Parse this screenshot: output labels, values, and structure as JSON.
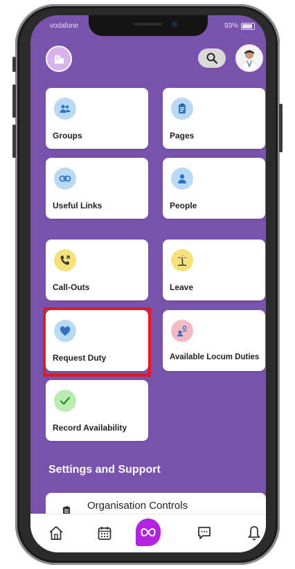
{
  "status": {
    "carrier": "vodafone",
    "battery": "93%"
  },
  "header": {
    "logo_icon": "building-icon",
    "search_icon": "search-icon",
    "avatar": "doctor-avatar"
  },
  "cards": [
    {
      "id": "groups",
      "label": "Groups",
      "icon": "people-icon",
      "icon_bg": "#b9d9f5",
      "icon_color": "#2f72c4"
    },
    {
      "id": "pages",
      "label": "Pages",
      "icon": "clipboard-icon",
      "icon_bg": "#b9d9f5",
      "icon_color": "#2f72c4"
    },
    {
      "id": "useful-links",
      "label": "Useful Links",
      "icon": "link-icon",
      "icon_bg": "#b9d9f5",
      "icon_color": "#2f72c4"
    },
    {
      "id": "people",
      "label": "People",
      "icon": "person-icon",
      "icon_bg": "#b9d9f5",
      "icon_color": "#2f72c4"
    },
    {
      "id": "call-outs",
      "label": "Call-Outs",
      "icon": "phone-callout-icon",
      "icon_bg": "#f5e27a",
      "icon_color": "#3a3a3a"
    },
    {
      "id": "leave",
      "label": "Leave",
      "icon": "palm-tree-icon",
      "icon_bg": "#f5e27a",
      "icon_color": "#3a3a3a"
    },
    {
      "id": "request-duty",
      "label": "Request Duty",
      "icon": "heart-icon",
      "icon_bg": "#b9d9f5",
      "icon_color": "#2f72c4"
    },
    {
      "id": "available-locum-duties",
      "label": "Available Locum Duties",
      "icon": "locum-person-icon",
      "icon_bg": "#f5b9c4",
      "icon_color": "#2f72c4"
    },
    {
      "id": "record-availability",
      "label": "Record Availability",
      "icon": "checkmark-icon",
      "icon_bg": "#b9ecb0",
      "icon_color": "#2e8b2e"
    }
  ],
  "settings": {
    "title": "Settings and Support",
    "org_controls": "Organisation Controls"
  },
  "tabbar": {
    "items": [
      "home-icon",
      "calendar-icon",
      "infinity-icon",
      "chat-icon",
      "bell-icon"
    ],
    "active_color": "#b323e0"
  },
  "colors": {
    "background": "#7852ad",
    "highlight": "#e01b1b"
  }
}
